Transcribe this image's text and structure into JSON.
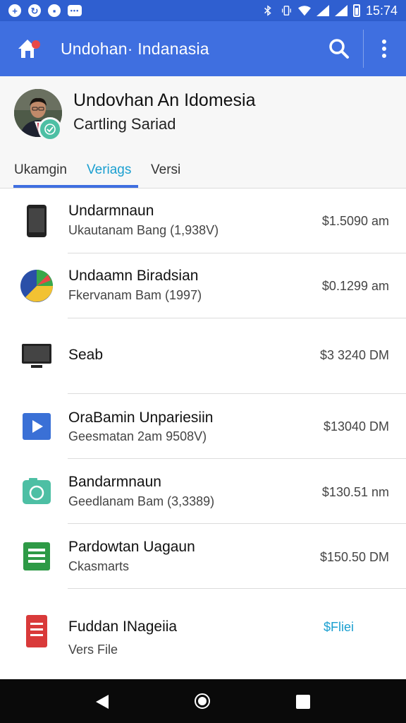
{
  "status_bar": {
    "time": "15:74",
    "left_icons": [
      "plus-circle-icon",
      "sync-icon",
      "media-icon",
      "message-icon"
    ],
    "right_icons": [
      "bluetooth-icon",
      "vibrate-icon",
      "wifi-icon",
      "signal-icon",
      "signal-icon",
      "battery-icon"
    ]
  },
  "app_bar": {
    "title": "Undohan· Indanasia",
    "icons": [
      "home-icon",
      "search-icon",
      "more-vert-icon"
    ],
    "color": "#3f6fe0"
  },
  "profile": {
    "name": "Undovhan An  Idomesia",
    "subtitle": "Cartling Sariad",
    "badge_icon": "check-circle-icon"
  },
  "tabs": [
    {
      "label": "Ukamgin",
      "active": false
    },
    {
      "label": "Veriags",
      "active": true
    },
    {
      "label": "Versi",
      "active": false
    }
  ],
  "list": [
    {
      "icon": "phone-icon",
      "title": "Undarmnaun",
      "subtitle": "Ukautanam Bang (1,938V)",
      "price": "$1.5090 am"
    },
    {
      "icon": "pie-chart-icon",
      "title": "Undaamn Biradsian",
      "subtitle": "Fkervanam Bam (1997)",
      "price": "$0.1299 am"
    },
    {
      "icon": "monitor-icon",
      "title": "Seab",
      "subtitle": "",
      "price": "$3 3240 DM"
    },
    {
      "icon": "play-icon",
      "title": "OraBamin Unpariesiin",
      "subtitle": "Geesmatan 2am 9508V)",
      "price": "$13040 DM"
    },
    {
      "icon": "camera-icon",
      "title": "Bandarmnaun",
      "subtitle": "Geedlanam Bam (3,3389)",
      "price": "$130.51 nm"
    },
    {
      "icon": "sheet-icon",
      "title": "Pardowtan Uagaun",
      "subtitle": "Ckasmarts",
      "price": "$150.50 DM"
    },
    {
      "icon": "document-icon",
      "title": "Fuddan INageiia",
      "subtitle": "Vers File",
      "price": "$Fliei"
    }
  ],
  "colors": {
    "accent": "#1a9fd0",
    "status_bar": "#2f5fd0",
    "badge": "#4dbfa4"
  },
  "nav_bar": {
    "icons": [
      "back-icon",
      "home-circle-icon",
      "recent-apps-icon"
    ]
  }
}
